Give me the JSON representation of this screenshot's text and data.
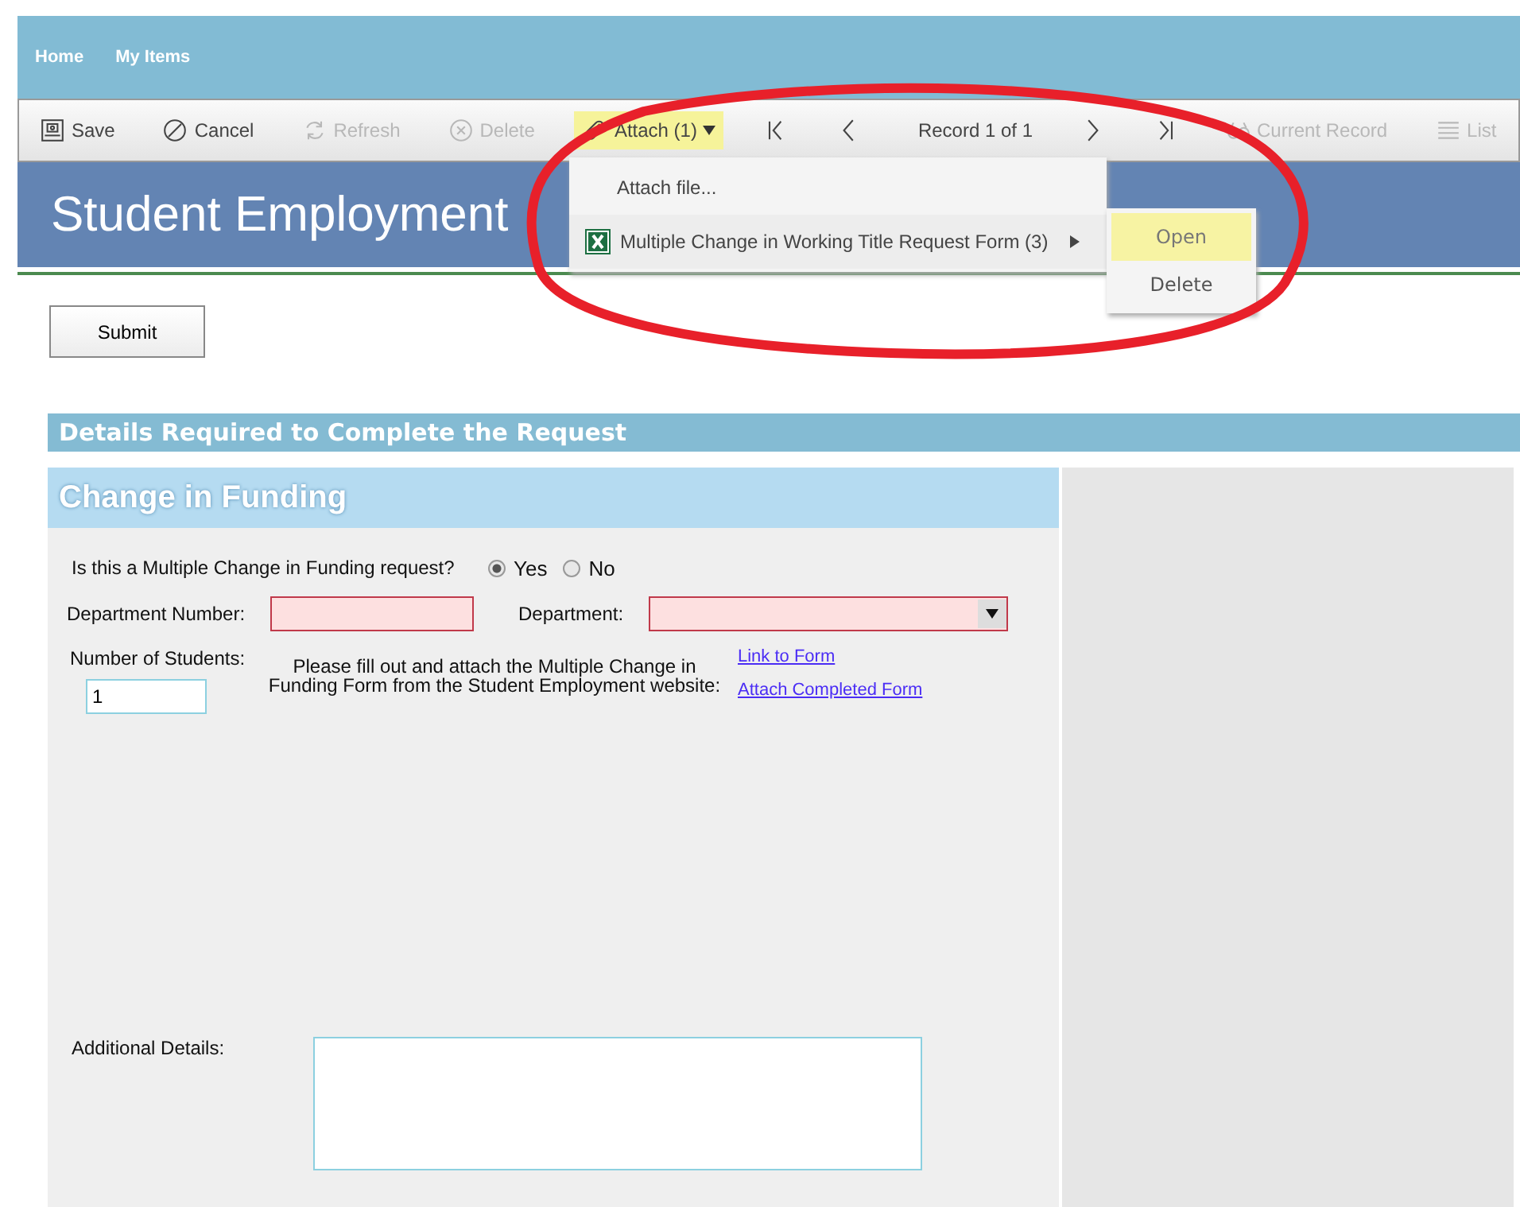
{
  "nav": [
    "Home",
    "My Items"
  ],
  "toolbar": [
    {
      "kind": "save",
      "label": "Save",
      "disabled": false,
      "highlighted": false
    },
    {
      "kind": "cancel",
      "label": "Cancel",
      "disabled": false,
      "highlighted": false
    },
    {
      "kind": "refresh",
      "label": "Refresh",
      "disabled": true,
      "highlighted": false
    },
    {
      "kind": "delete",
      "label": "Delete",
      "disabled": true,
      "highlighted": false
    },
    {
      "kind": "attach",
      "label": "Attach (1)",
      "disabled": false,
      "highlighted": true
    },
    {
      "kind": "first",
      "disabled": false,
      "highlighted": false
    },
    {
      "kind": "prev",
      "disabled": false,
      "highlighted": false
    },
    {
      "kind": "record",
      "label": "Record 1 of 1",
      "disabled": false,
      "highlighted": false
    },
    {
      "kind": "next",
      "disabled": false,
      "highlighted": false
    },
    {
      "kind": "last",
      "disabled": false,
      "highlighted": false
    },
    {
      "kind": "current",
      "label": "Current Record",
      "disabled": true,
      "highlighted": false
    },
    {
      "kind": "list",
      "label": "List",
      "disabled": true,
      "highlighted": false
    }
  ],
  "attach_menu": {
    "items": [
      {
        "label": "Attach file...",
        "kind": "action"
      },
      {
        "label": "Multiple Change in Working Title Request Form (3)",
        "kind": "file"
      }
    ],
    "submenu": [
      {
        "label": "Open",
        "selected": true
      },
      {
        "label": "Delete",
        "selected": false
      }
    ]
  },
  "title": "Student Employment",
  "submit": "Submit",
  "section_header": "Details Required to Complete the Request",
  "panel": {
    "title": "Change in Funding",
    "question": "Is this a Multiple Change in Funding request?",
    "options": [
      {
        "label": "Yes",
        "selected": true
      },
      {
        "label": "No",
        "selected": false
      }
    ],
    "department_number": {
      "label": "Department Number:",
      "invalid": true
    },
    "department": {
      "label": "Department:",
      "invalid": true
    },
    "students": {
      "label": "Number of Students:",
      "value": "1"
    },
    "instructions": "Please fill out and attach the Multiple Change in Funding Form from the Student Employment website:",
    "links": [
      "Link to Form",
      "Attach Completed Form"
    ],
    "additional": {
      "label": "Additional Details:"
    }
  }
}
